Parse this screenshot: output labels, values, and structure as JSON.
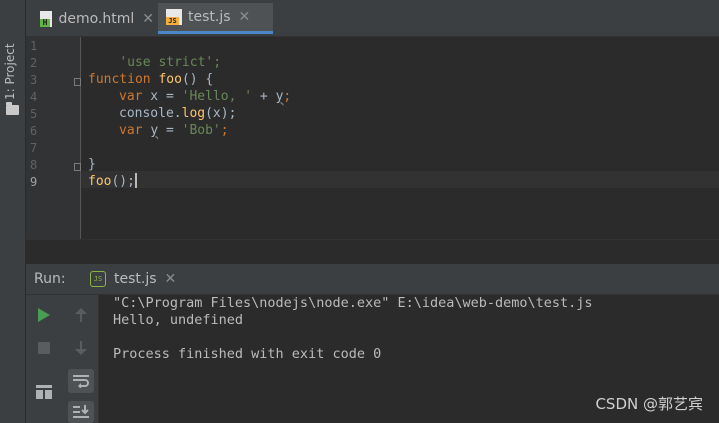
{
  "sidebar": {
    "project_tab_label": "1: Project"
  },
  "editor": {
    "tabs": [
      {
        "label": "demo.html",
        "icon": "html-file-icon",
        "active": false
      },
      {
        "label": "test.js",
        "icon": "js-file-icon",
        "active": true
      }
    ],
    "line_numbers": [
      "1",
      "2",
      "3",
      "4",
      "5",
      "6",
      "7",
      "8",
      "9"
    ],
    "current_line": "9",
    "code": {
      "l1": {
        "str": "'use strict';"
      },
      "l3": {
        "kw": "function",
        "fn": "foo",
        "rest": "() {"
      },
      "l4": {
        "kw": "var",
        "plain1": " x = ",
        "str": "'Hello, '",
        "plain2": " + ",
        "var_u": "y",
        "end": ";"
      },
      "l5": {
        "plain1": "console.",
        "method": "log",
        "plain2": "(x);"
      },
      "l6": {
        "kw": "var",
        "plain1": " ",
        "var_u": "y",
        "plain2": " = ",
        "str": "'Bob'",
        "end": ";"
      },
      "l8": {
        "plain": "}"
      },
      "l9": {
        "fn": "foo",
        "plain": "();"
      }
    }
  },
  "run": {
    "label": "Run:",
    "tab_label": "test.js",
    "output": [
      "\"C:\\Program Files\\nodejs\\node.exe\" E:\\idea\\web-demo\\test.js",
      "Hello, undefined",
      "",
      "Process finished with exit code 0"
    ],
    "toolbar": [
      "run-icon",
      "stop-icon",
      "layout-icon",
      "up-arrow-icon",
      "down-arrow-icon",
      "soft-wrap-icon",
      "scroll-to-end-icon"
    ]
  },
  "watermark": "CSDN @郭艺宾",
  "colors": {
    "accent": "#4a88c7",
    "run_green": "#499c54",
    "keyword": "#cc7832",
    "string": "#6a8759",
    "function": "#ffc66d"
  }
}
